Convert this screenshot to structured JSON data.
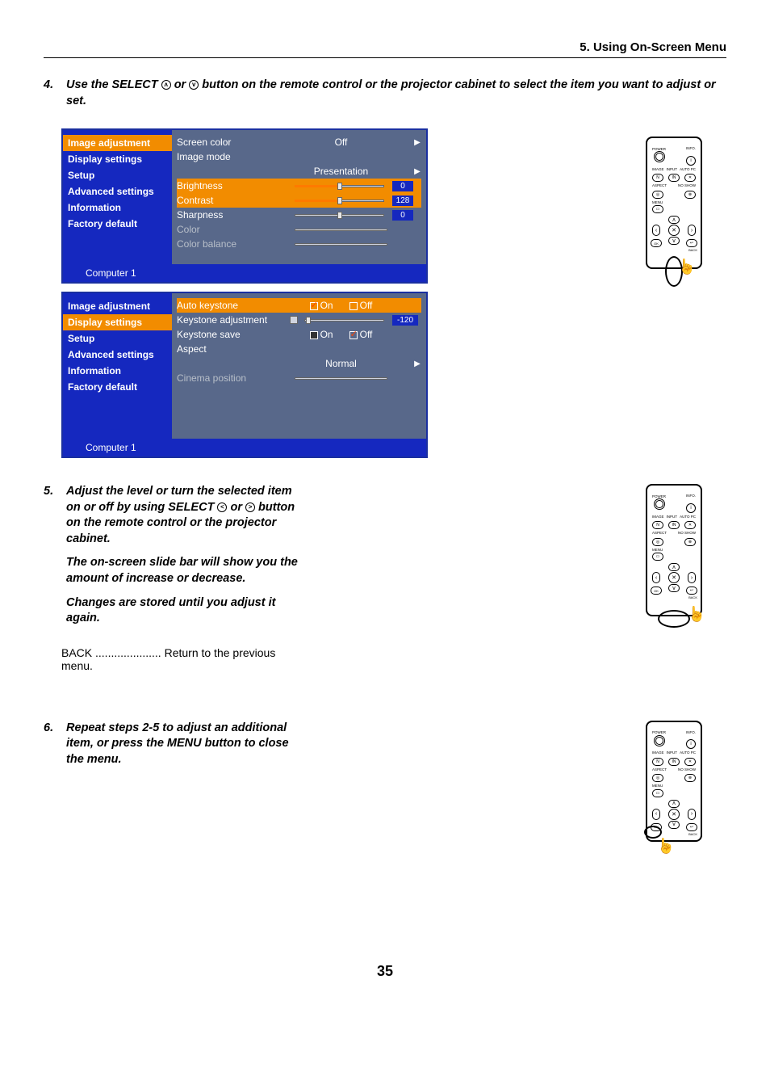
{
  "header": {
    "title": "5. Using On-Screen Menu"
  },
  "step4": {
    "num": "4.",
    "text_a": "Use the SELECT ",
    "text_b": " or ",
    "text_c": " button on the remote control or the projector cabinet to select the item you want to adjust or set.",
    "icon_up": "ᴧ",
    "icon_down": "ᴠ"
  },
  "osd_nav": [
    "Image adjustment",
    "Display settings",
    "Setup",
    "Advanced settings",
    "Information",
    "Factory default"
  ],
  "osd1": {
    "active_nav_index": 0,
    "rows": [
      {
        "label": "Screen color",
        "value": "Off",
        "arrow": true
      },
      {
        "label": "Image mode",
        "value": ""
      },
      {
        "label": "",
        "value": "Presentation",
        "arrow": true,
        "indent": true
      },
      {
        "label": "Brightness",
        "slider": {
          "fill": 50,
          "thumb": 50
        },
        "num": "0",
        "hl": true
      },
      {
        "label": "Contrast",
        "slider": {
          "fill": 50,
          "thumb": 50,
          "fillcolor": "#ff7a00"
        },
        "num": "128",
        "hl": true
      },
      {
        "label": "Sharpness",
        "slider": {
          "fill": 0,
          "thumb": 50
        },
        "num": "0"
      },
      {
        "label": "Color",
        "slider": {
          "fill": 0,
          "thumb": null
        },
        "disabled": true
      },
      {
        "label": "Color balance",
        "slider": {
          "fill": 0,
          "thumb": null
        },
        "disabled": true
      }
    ],
    "footer": "Computer 1"
  },
  "osd2": {
    "active_nav_index": 1,
    "rows": [
      {
        "label": "Auto keystone",
        "on_checked": true,
        "off_checked": false,
        "hl": true
      },
      {
        "label": "Keystone adjustment",
        "kslider": true,
        "num": "-120"
      },
      {
        "label": "Keystone save",
        "on_checked": false,
        "off_checked": true,
        "dark": true
      },
      {
        "label": "Aspect",
        "value": ""
      },
      {
        "label": "",
        "value": "Normal",
        "arrow": true,
        "indent": true
      },
      {
        "label": "Cinema position",
        "slider": {
          "fill": 0,
          "thumb": null
        },
        "disabled": true
      }
    ],
    "footer": "Computer 1",
    "on_label": "On",
    "off_label": "Off"
  },
  "step5": {
    "num": "5.",
    "p1a": "Adjust the level or turn the selected item on or off by using SELECT ",
    "p1b": " or ",
    "p1c": " button on the remote control or the projector cabinet.",
    "icon_left": "<",
    "icon_right": ">",
    "p2": "The on-screen slide bar will show you the amount of increase or decrease.",
    "p3": "Changes are stored until you adjust it again.",
    "back_line": "BACK ..................... Return to the previous menu."
  },
  "step6": {
    "num": "6.",
    "text": "Repeat steps 2-5 to adjust an additional item, or press the MENU button to close the menu."
  },
  "remote": {
    "power": "POWER",
    "info": "INFO.",
    "image": "IMAGE",
    "input": "INPUT",
    "autopc": "AUTO PC",
    "aspect": "ASPECT",
    "noshow": "NO SHOW",
    "menu": "MENU",
    "ok": "OK",
    "back": "BACK",
    "n_btn": "N",
    "in_btn": "IN",
    "x_btn": "✕",
    "cross": "✕"
  },
  "page_number": "35"
}
